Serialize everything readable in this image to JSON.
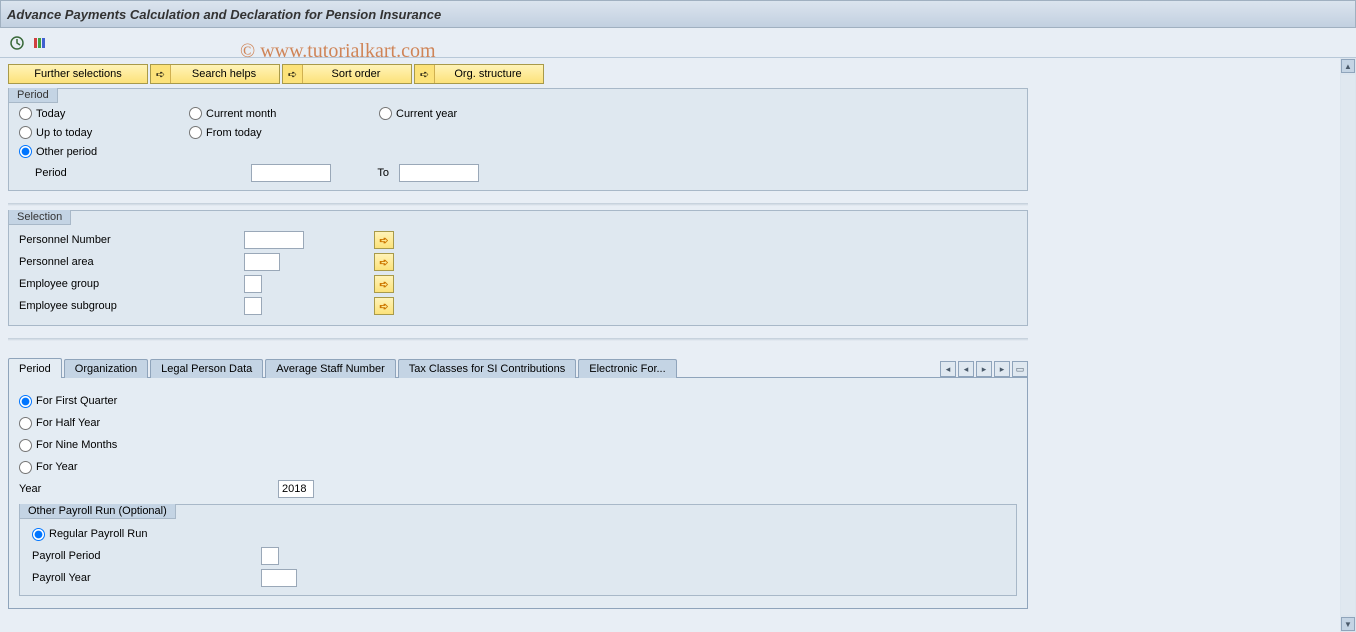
{
  "title": "Advance Payments Calculation and Declaration for Pension Insurance",
  "watermark": "© www.tutorialkart.com",
  "action_buttons": {
    "further_selections": "Further selections",
    "search_helps": "Search helps",
    "sort_order": "Sort order",
    "org_structure": "Org. structure"
  },
  "period": {
    "group_label": "Period",
    "today": "Today",
    "current_month": "Current month",
    "current_year": "Current year",
    "up_to_today": "Up to today",
    "from_today": "From today",
    "other_period": "Other period",
    "period_label": "Period",
    "to_label": "To",
    "period_from": "",
    "period_to": "",
    "selected": "other_period"
  },
  "selection": {
    "group_label": "Selection",
    "personnel_number": "Personnel Number",
    "personnel_area": "Personnel area",
    "employee_group": "Employee group",
    "employee_subgroup": "Employee subgroup",
    "personnel_number_val": "",
    "personnel_area_val": "",
    "employee_group_val": "",
    "employee_subgroup_val": ""
  },
  "tabs": {
    "period": "Period",
    "organization": "Organization",
    "legal_person_data": "Legal Person Data",
    "average_staff_number": "Average Staff Number",
    "tax_classes": "Tax Classes for SI Contributions",
    "electronic_format": "Electronic For..."
  },
  "tab_period": {
    "first_quarter": "For First Quarter",
    "half_year": "For Half Year",
    "nine_months": "For Nine Months",
    "for_year": "For Year",
    "year_label": "Year",
    "year_value": "2018",
    "other_payroll_run": "Other Payroll Run (Optional)",
    "regular_payroll_run": "Regular Payroll Run",
    "payroll_period": "Payroll Period",
    "payroll_year": "Payroll Year",
    "payroll_period_val": "",
    "payroll_year_val": ""
  }
}
